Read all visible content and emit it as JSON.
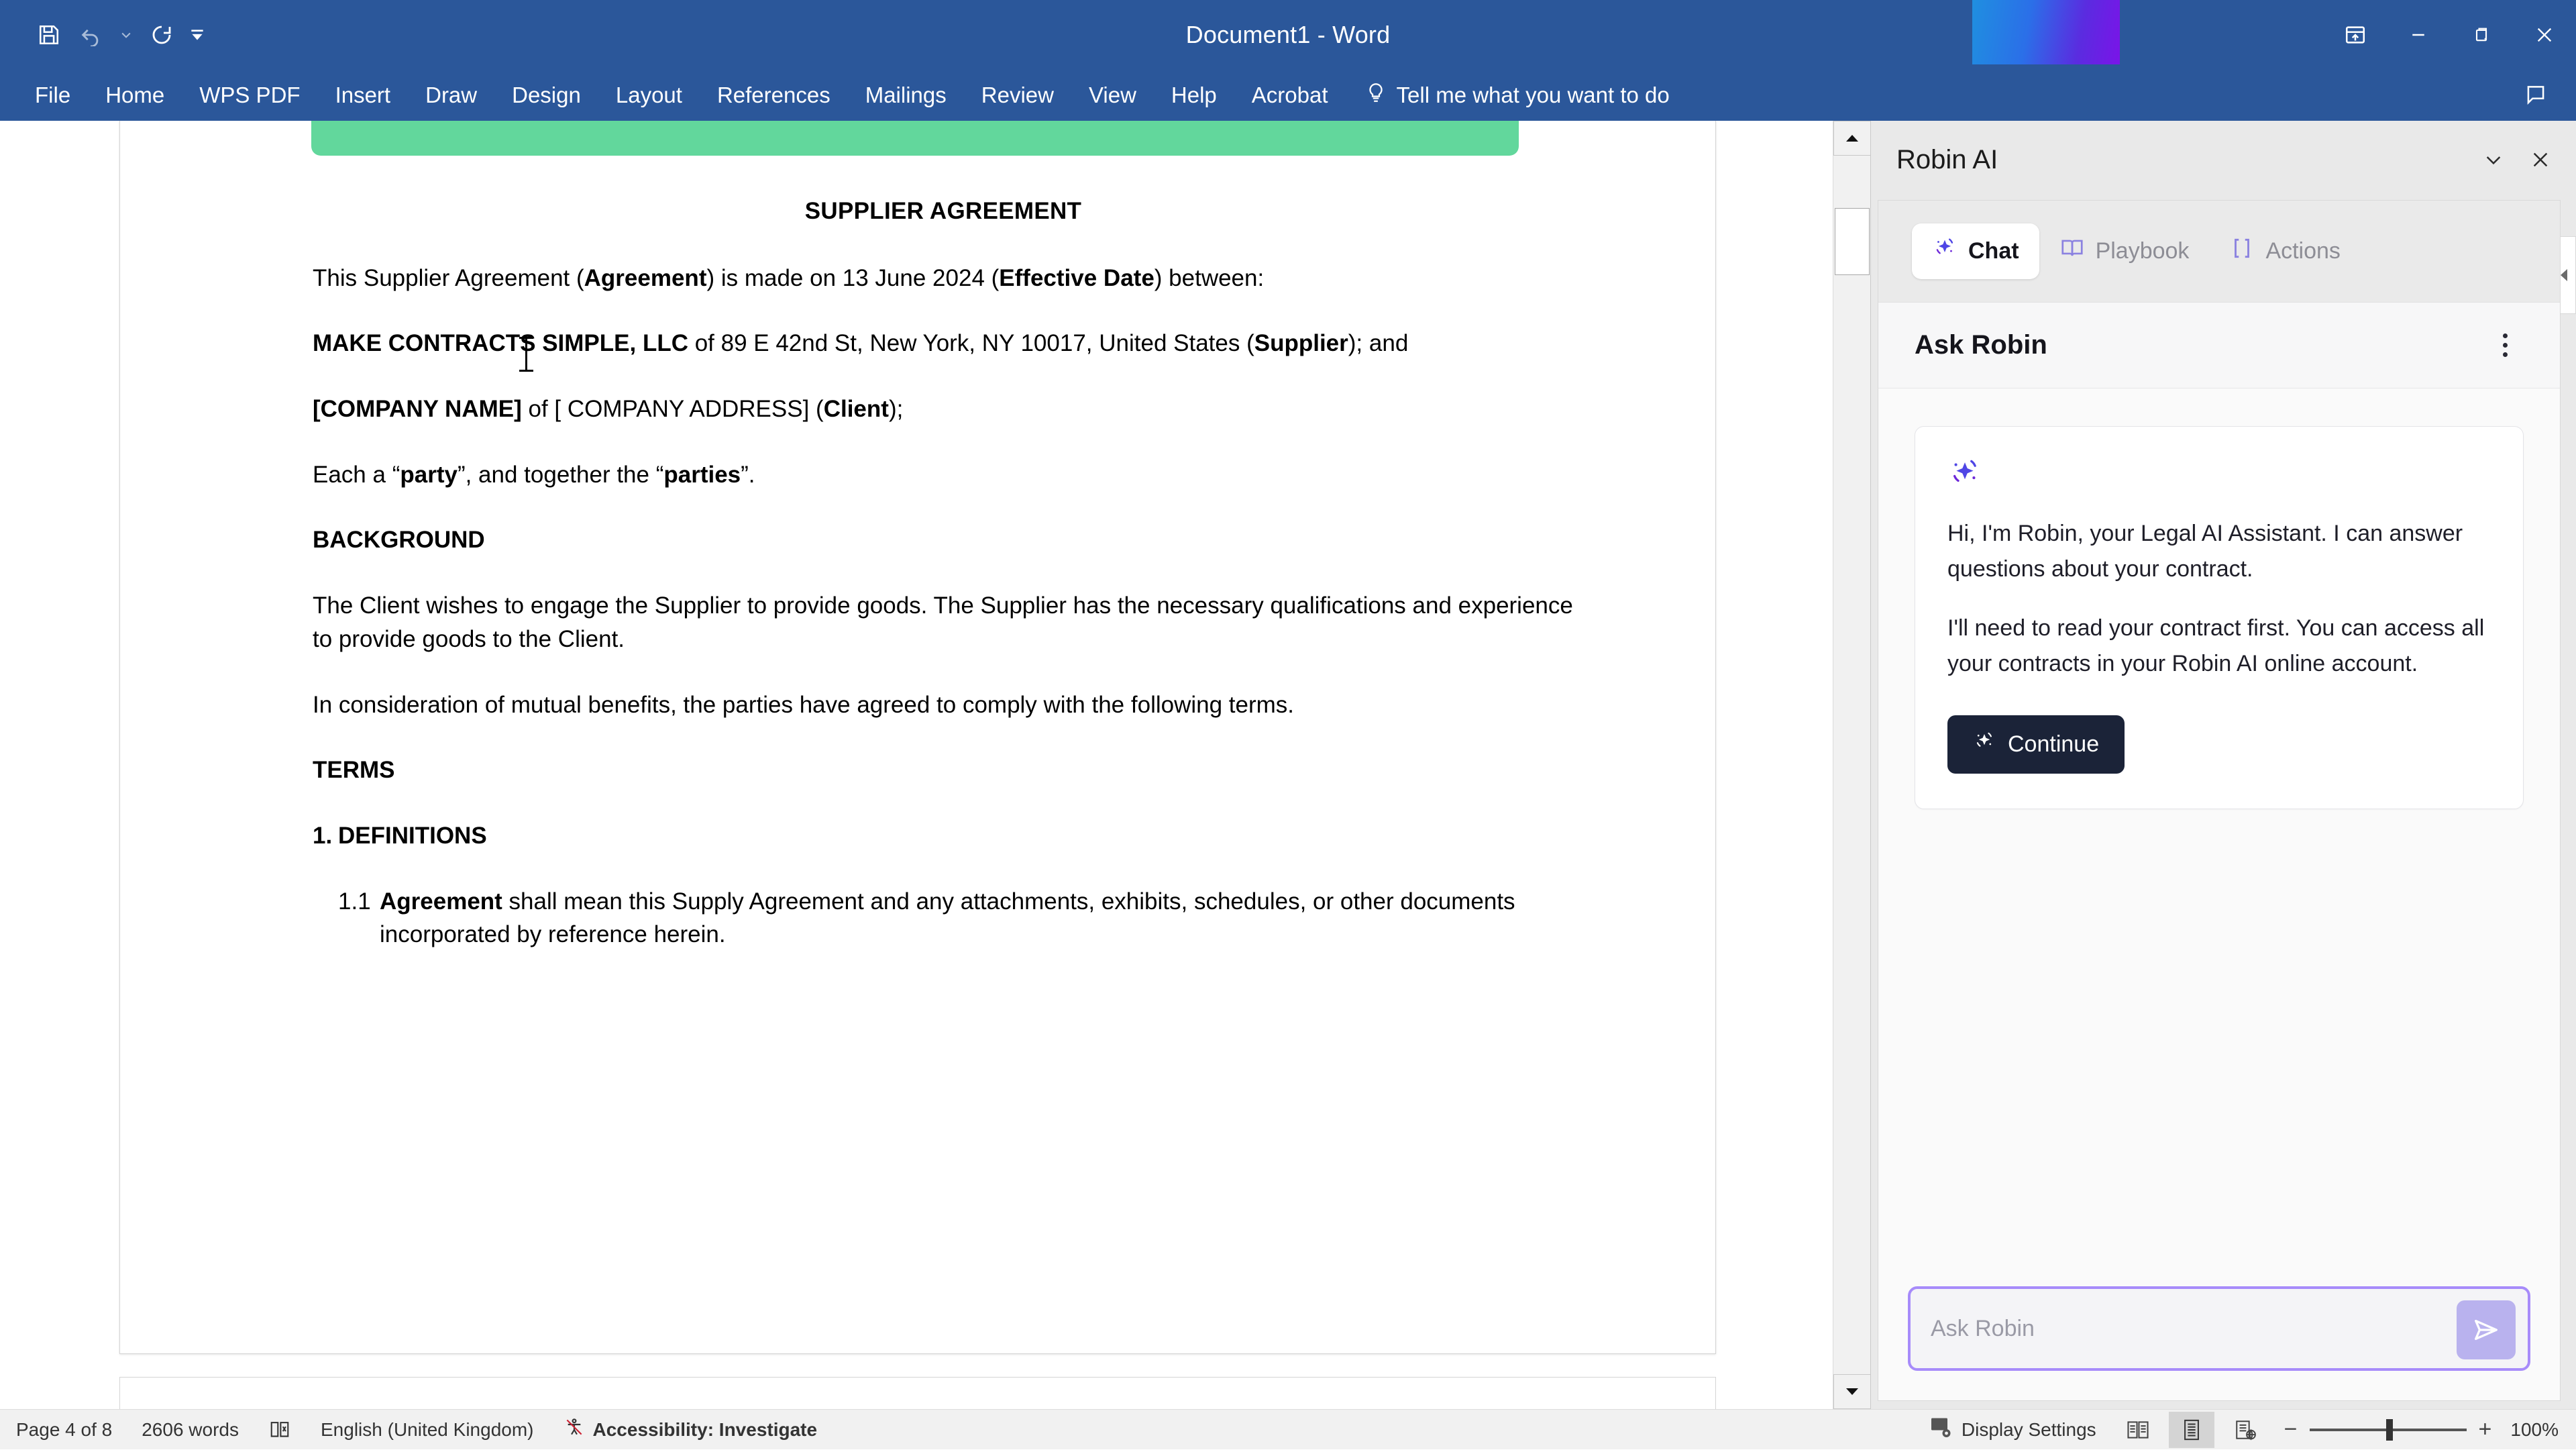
{
  "window": {
    "title": "Document1  -  Word",
    "quick_access": [
      {
        "name": "save",
        "icon": "save-icon"
      },
      {
        "name": "undo",
        "icon": "undo-icon"
      },
      {
        "name": "undo-dropdown",
        "icon": "chevron-down-icon"
      },
      {
        "name": "redo",
        "icon": "redo-icon"
      },
      {
        "name": "customize-qat",
        "icon": "customize-toolbar-icon"
      }
    ],
    "controls": [
      {
        "name": "ribbon-display-options",
        "icon": "ribbon-options-icon"
      },
      {
        "name": "minimize",
        "icon": "minimize-icon"
      },
      {
        "name": "restore",
        "icon": "restore-icon"
      },
      {
        "name": "close",
        "icon": "close-icon"
      }
    ]
  },
  "ribbon": {
    "tabs": [
      {
        "label": "File"
      },
      {
        "label": "Home"
      },
      {
        "label": "WPS PDF"
      },
      {
        "label": "Insert"
      },
      {
        "label": "Draw"
      },
      {
        "label": "Design"
      },
      {
        "label": "Layout"
      },
      {
        "label": "References"
      },
      {
        "label": "Mailings"
      },
      {
        "label": "Review"
      },
      {
        "label": "View"
      },
      {
        "label": "Help"
      },
      {
        "label": "Acrobat"
      }
    ],
    "tell_me": "Tell me what you want to do"
  },
  "document": {
    "title": "SUPPLIER AGREEMENT",
    "intro": {
      "pre": "This Supplier Agreement (",
      "b1": "Agreement",
      "mid": ") is made on 13 June 2024 (",
      "b2": "Effective Date",
      "post": ") between:"
    },
    "supplier": {
      "b1": "MAKE CONTRACTS SIMPLE, LLC",
      "mid": " of 89 E 42nd St, New York, NY 10017, United States (",
      "b2": "Supplier",
      "post": "); and"
    },
    "client": {
      "b1": "[COMPANY NAME]",
      "mid": " of [ COMPANY ADDRESS] (",
      "b2": "Client",
      "post": ");"
    },
    "parties": {
      "pre": "Each a “",
      "b1": "party",
      "mid": "”, and together the “",
      "b2": "parties",
      "post": "”."
    },
    "background_heading": "BACKGROUND",
    "background_p1": "The Client wishes to engage the Supplier to provide goods. The Supplier has the necessary qualifications and experience to provide goods to the Client.",
    "background_p2": "In consideration of mutual benefits, the parties have agreed to comply with the following terms.",
    "terms_heading": "TERMS",
    "clause_1_num": "1.",
    "clause_1_title": "DEFINITIONS",
    "clause_11_num": "1.1",
    "clause_11": {
      "b1": "Agreement",
      "rest": " shall mean this Supply Agreement and any attachments, exhibits, schedules, or other documents incorporated by reference herein."
    }
  },
  "panel": {
    "title": "Robin AI",
    "header_buttons": [
      {
        "name": "collapse",
        "icon": "chevron-down-icon"
      },
      {
        "name": "close",
        "icon": "close-icon"
      }
    ],
    "tabs": [
      {
        "label": "Chat",
        "icon": "sparkle-icon",
        "active": true
      },
      {
        "label": "Playbook",
        "icon": "book-icon",
        "active": false
      },
      {
        "label": "Actions",
        "icon": "brackets-icon",
        "active": false
      }
    ],
    "section_title": "Ask Robin",
    "message": {
      "p1": "Hi, I'm Robin, your Legal AI Assistant. I can answer questions about your contract.",
      "p2": "I'll need to read your contract first. You can access all your contracts in your Robin AI online account.",
      "cta": "Continue"
    },
    "input_placeholder": "Ask Robin"
  },
  "statusbar": {
    "page": "Page 4 of 8",
    "words": "2606 words",
    "language": "English (United Kingdom)",
    "accessibility": "Accessibility: Investigate",
    "display_settings": "Display Settings",
    "views": [
      {
        "name": "read-mode",
        "active": false
      },
      {
        "name": "print-layout",
        "active": true
      },
      {
        "name": "web-layout",
        "active": false
      }
    ],
    "zoom_out": "−",
    "zoom_in": "+",
    "zoom_level": "100%"
  },
  "colors": {
    "word_blue": "#2b579a",
    "accent_purple": "#a78bfa",
    "cta_dark": "#1b2338",
    "banner_green": "#62d79c"
  }
}
